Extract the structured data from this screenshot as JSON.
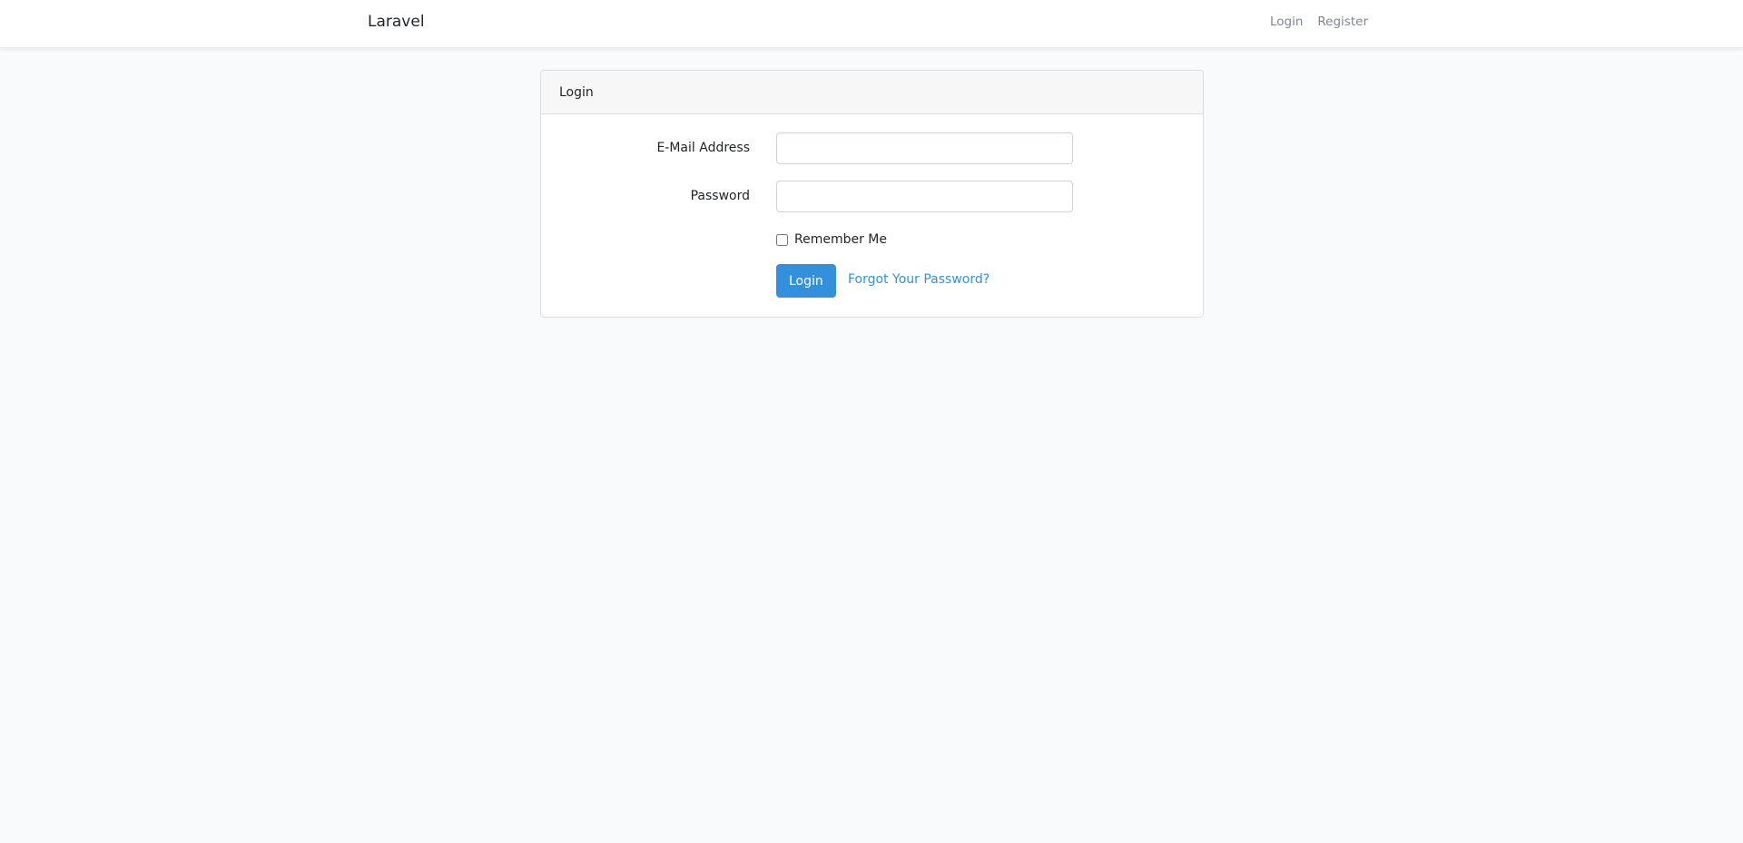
{
  "navbar": {
    "brand": "Laravel",
    "links": [
      {
        "label": "Login"
      },
      {
        "label": "Register"
      }
    ]
  },
  "login_card": {
    "header": "Login",
    "email": {
      "label": "E-Mail Address",
      "value": "",
      "placeholder": ""
    },
    "password": {
      "label": "Password",
      "value": "",
      "placeholder": ""
    },
    "remember": {
      "label": "Remember Me",
      "checked": false
    },
    "submit_label": "Login",
    "forgot_label": "Forgot Your Password?"
  },
  "colors": {
    "background": "#f8fafc",
    "primary": "#3490dc",
    "nav_link": "#7f8791"
  }
}
